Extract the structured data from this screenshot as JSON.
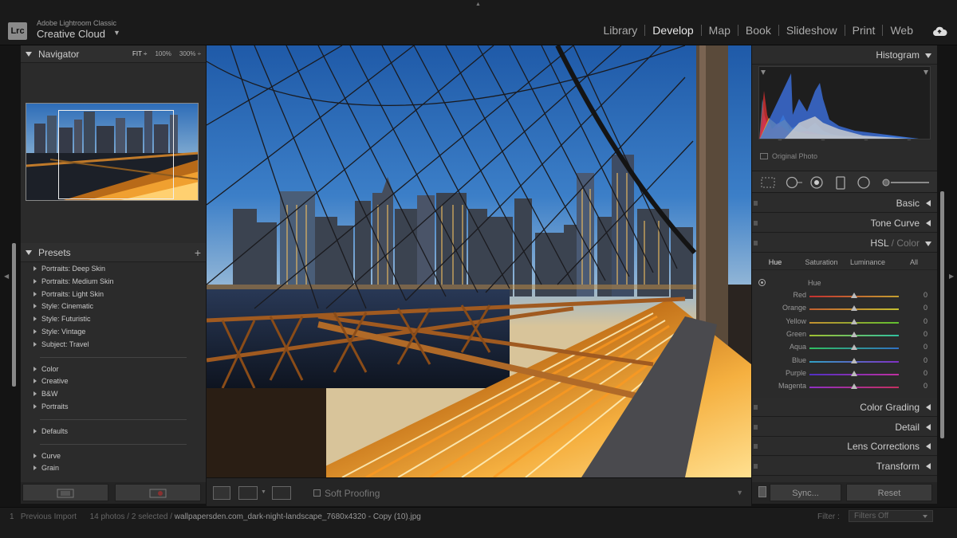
{
  "app": {
    "badge": "Lrc",
    "product": "Adobe Lightroom Classic",
    "account": "Creative Cloud"
  },
  "modules": [
    "Library",
    "Develop",
    "Map",
    "Book",
    "Slideshow",
    "Print",
    "Web"
  ],
  "active_module": "Develop",
  "navigator": {
    "title": "Navigator",
    "zoom": [
      "FIT ÷",
      "100%",
      "300% ÷"
    ]
  },
  "presets": {
    "title": "Presets",
    "group1": [
      "Portraits: Deep Skin",
      "Portraits: Medium Skin",
      "Portraits: Light Skin",
      "Style: Cinematic",
      "Style: Futuristic",
      "Style: Vintage",
      "Subject: Travel"
    ],
    "group2": [
      "Color",
      "Creative",
      "B&W",
      "Portraits"
    ],
    "group3": [
      "Defaults"
    ],
    "group4": [
      "Curve",
      "Grain"
    ]
  },
  "toolbar": {
    "soft_proofing": "Soft Proofing"
  },
  "histogram": {
    "title": "Histogram",
    "original_photo": "Original Photo",
    "ticks": [
      "–",
      "–",
      "–",
      "–"
    ]
  },
  "panels": {
    "basic": "Basic",
    "tone_curve": "Tone Curve",
    "hsl": "HSL",
    "hsl_sep": " / ",
    "color": "Color",
    "color_grading": "Color Grading",
    "detail": "Detail",
    "lens_corrections": "Lens Corrections",
    "transform": "Transform"
  },
  "hsl": {
    "tabs": [
      "Hue",
      "Saturation",
      "Luminance",
      "All"
    ],
    "active_tab": "Hue",
    "section": "Hue",
    "sliders": [
      {
        "label": "Red",
        "value": "0",
        "gradient": "#c43030,#c4a030"
      },
      {
        "label": "Orange",
        "value": "0",
        "gradient": "#c46030,#c4c030"
      },
      {
        "label": "Yellow",
        "value": "0",
        "gradient": "#c49030,#60c030"
      },
      {
        "label": "Green",
        "value": "0",
        "gradient": "#a0c030,#30c0a0"
      },
      {
        "label": "Aqua",
        "value": "0",
        "gradient": "#30c060,#3070c4"
      },
      {
        "label": "Blue",
        "value": "0",
        "gradient": "#30a0c4,#8030c4"
      },
      {
        "label": "Purple",
        "value": "0",
        "gradient": "#5030c4,#c030a0"
      },
      {
        "label": "Magenta",
        "value": "0",
        "gradient": "#9030c4,#c43060"
      }
    ]
  },
  "buttons": {
    "sync": "Sync...",
    "reset": "Reset"
  },
  "filmstrip": {
    "source": "1   Previous Import",
    "count": "14 photos / 2 selected /",
    "filename": "wallpapersden.com_dark-night-landscape_7680x4320 - Copy (10).jpg",
    "filter_label": "Filter :",
    "filter_value": "Filters Off"
  }
}
